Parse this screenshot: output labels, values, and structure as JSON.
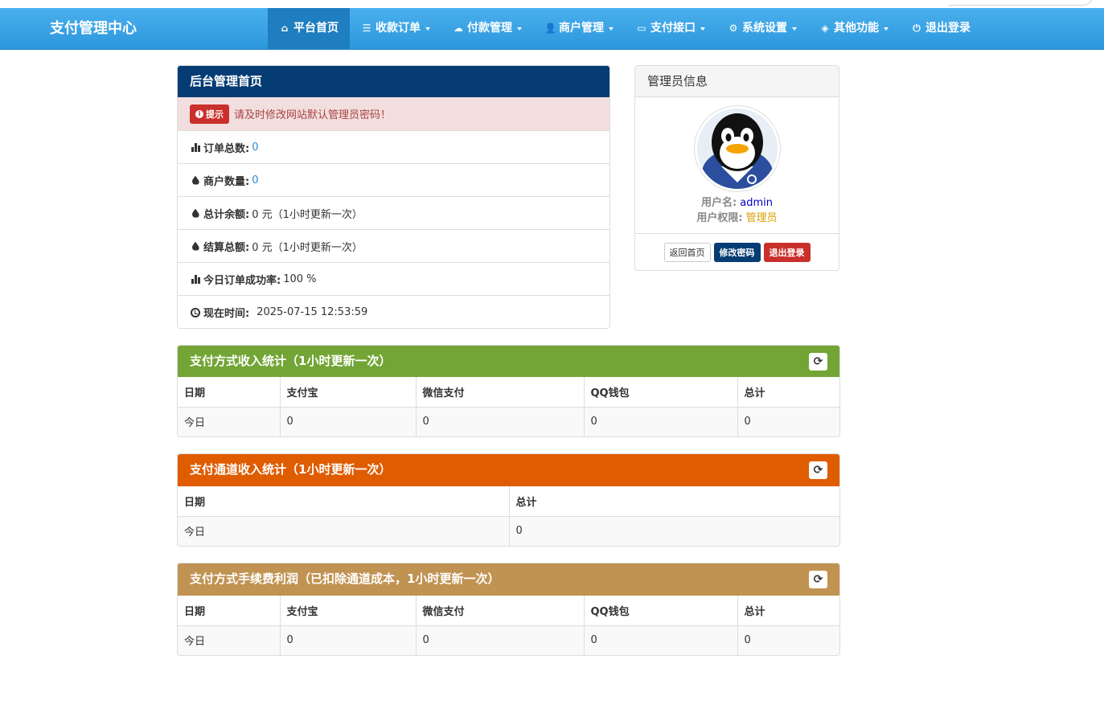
{
  "brand": "支付管理中心",
  "nav": [
    {
      "icon": "home-icon",
      "glyph": "⌂",
      "label": "平台首页",
      "dropdown": false,
      "active": true
    },
    {
      "icon": "list-icon",
      "glyph": "☰",
      "label": "收款订单",
      "dropdown": true
    },
    {
      "icon": "cloud-icon",
      "glyph": "☁",
      "label": "付款管理",
      "dropdown": true
    },
    {
      "icon": "user-icon",
      "glyph": "👤",
      "label": "商户管理",
      "dropdown": true
    },
    {
      "icon": "credit-card-icon",
      "glyph": "▭",
      "label": "支付接口",
      "dropdown": true
    },
    {
      "icon": "gear-icon",
      "glyph": "⚙",
      "label": "系统设置",
      "dropdown": true
    },
    {
      "icon": "cube-icon",
      "glyph": "◈",
      "label": "其他功能",
      "dropdown": true
    },
    {
      "icon": "power-icon",
      "glyph": "⏻",
      "label": "退出登录",
      "dropdown": false
    }
  ],
  "main_panel": {
    "title": "后台管理首页",
    "alert": {
      "badge": "提示",
      "text": "请及时修改网站默认管理员密码！"
    },
    "rows": [
      {
        "icon": "bar-chart-icon",
        "label": "订单总数:",
        "value": "0",
        "link": true
      },
      {
        "icon": "drop-icon",
        "label": "商户数量:",
        "value": "0",
        "link": true
      },
      {
        "icon": "drop-icon",
        "label": "总计余额:",
        "value": "0 元（1小时更新一次）",
        "link": false
      },
      {
        "icon": "drop-icon",
        "label": "结算总额:",
        "value": "0 元（1小时更新一次）",
        "link": false
      },
      {
        "icon": "bar-chart-icon",
        "label": "今日订单成功率:",
        "value": "100 %",
        "link": false
      },
      {
        "icon": "clock-icon",
        "label": "现在时间:",
        "value": "2025-07-15 12:53:59",
        "link": false
      }
    ]
  },
  "admin_panel": {
    "title": "管理员信息",
    "username_label": "用户名:",
    "username": "admin",
    "role_label": "用户权限:",
    "role": "管理员",
    "buttons": {
      "home": "返回首页",
      "password": "修改密码",
      "logout": "退出登录"
    }
  },
  "stat_panels": [
    {
      "title": "支付方式收入统计（1小时更新一次）",
      "color": "#72a535",
      "headers": [
        "日期",
        "支付宝",
        "微信支付",
        "QQ钱包",
        "总计"
      ],
      "rows": [
        [
          "今日",
          "0",
          "0",
          "0",
          "0"
        ]
      ]
    },
    {
      "title": "支付通道收入统计（1小时更新一次）",
      "color": "#e05c00",
      "headers": [
        "日期",
        "总计"
      ],
      "rows": [
        [
          "今日",
          "0"
        ]
      ]
    },
    {
      "title": "支付方式手续费利润（已扣除通道成本，1小时更新一次）",
      "color": "#c19352",
      "headers": [
        "日期",
        "支付宝",
        "微信支付",
        "QQ钱包",
        "总计"
      ],
      "rows": [
        [
          "今日",
          "0",
          "0",
          "0",
          "0"
        ]
      ]
    }
  ],
  "refresh_glyph": "⟳"
}
